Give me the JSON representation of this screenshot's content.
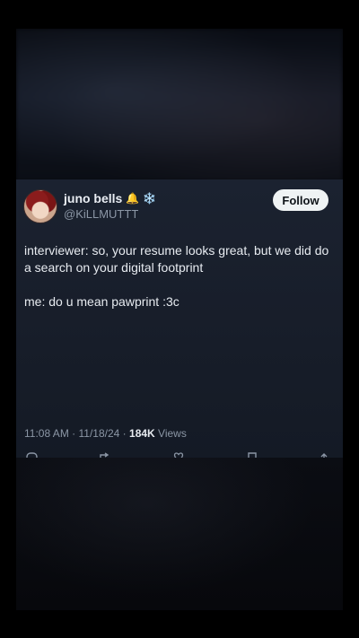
{
  "tweet": {
    "display_name": "juno bells",
    "name_emojis": [
      "🔔",
      "❄️"
    ],
    "handle": "@KiLLMUTTT",
    "follow_label": "Follow",
    "lines": [
      "interviewer: so, your resume looks great, but we did do a search on your digital footprint",
      "me: do u mean pawprint :3c"
    ],
    "time": "11:08 AM",
    "date": "11/18/24",
    "separator": "·",
    "views_count": "184K",
    "views_label": "Views"
  },
  "icons": {
    "reply": "reply-icon",
    "retweet": "retweet-icon",
    "like": "heart-icon",
    "bookmark": "bookmark-icon",
    "share": "share-icon"
  },
  "colors": {
    "card_bg": "#1b2230",
    "text": "#e7ebf0",
    "muted": "#8b96a5",
    "follow_bg": "#eff3f4"
  }
}
